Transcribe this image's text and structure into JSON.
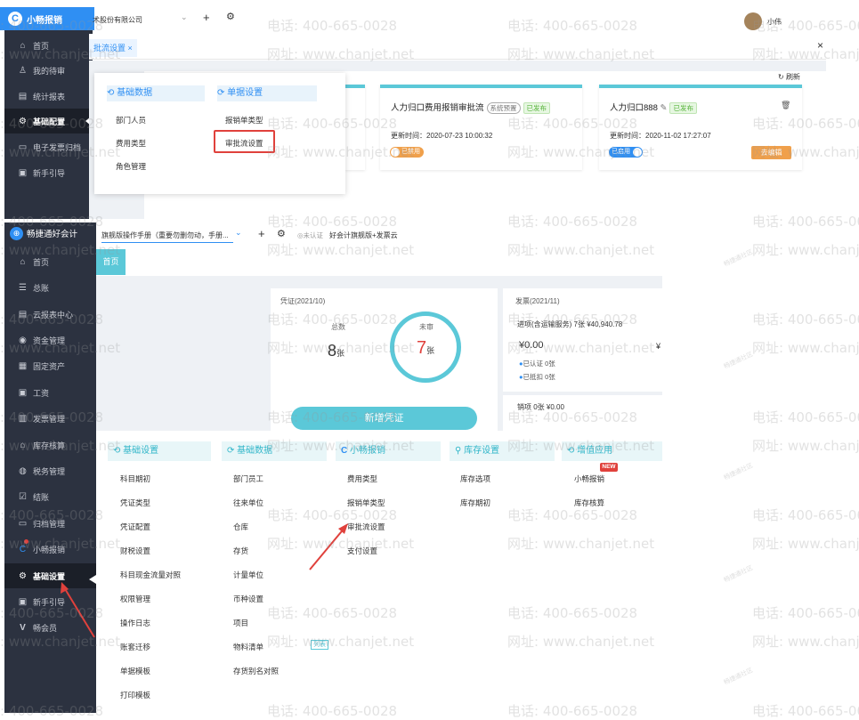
{
  "top": {
    "brand": "小畅报销",
    "company": "术股份有限公司",
    "user_name": "小伟",
    "tab_label": "批流设置",
    "refresh_label": "刷新",
    "sidebar": [
      {
        "label": "首页",
        "icon": "home-icon"
      },
      {
        "label": "我的待审",
        "icon": "person-icon"
      },
      {
        "label": "统计报表",
        "icon": "chart-icon"
      },
      {
        "label": "基础配置",
        "icon": "gear-icon",
        "active": true
      },
      {
        "label": "电子发票归档",
        "icon": "archive-icon"
      },
      {
        "label": "新手引导",
        "icon": "guide-icon"
      }
    ],
    "dropdown": {
      "basic_data_title": "基础数据",
      "basic_data_items": [
        "部门人员",
        "费用类型",
        "角色管理"
      ],
      "doc_settings_title": "单据设置",
      "doc_settings_items": [
        "报销单类型",
        "审批流设置"
      ]
    },
    "cards": [
      {
        "title": "人力归口费用报销审批流",
        "sys_badge": "系统预置",
        "status": "已发布",
        "time": "更新时间：2020-07-23 10:00:32",
        "toggle": "已禁用"
      },
      {
        "title": "人力归口888",
        "status": "已发布",
        "time": "更新时间：2020-11-02 17:27:07",
        "toggle": "已启用",
        "button": "去编辑"
      }
    ]
  },
  "bottom": {
    "brand": "畅捷通好会计",
    "account_select": "旗舰版操作手册（重要勿删勿动，手册...",
    "cert_status": "未认证",
    "account_plan": "好会计旗舰版+发票云",
    "home_tab": "首页",
    "sidebar": [
      {
        "label": "首页",
        "icon": "home-icon"
      },
      {
        "label": "总账",
        "icon": "ledger-icon"
      },
      {
        "label": "云报表中心",
        "icon": "chart-icon"
      },
      {
        "label": "资金管理",
        "icon": "money-icon"
      },
      {
        "label": "固定资产",
        "icon": "asset-icon"
      },
      {
        "label": "工资",
        "icon": "salary-icon"
      },
      {
        "label": "发票管理",
        "icon": "invoice-icon"
      },
      {
        "label": "库存核算",
        "icon": "warehouse-icon"
      },
      {
        "label": "税务管理",
        "icon": "tax-icon"
      },
      {
        "label": "结账",
        "icon": "checkout-icon"
      },
      {
        "label": "归档管理",
        "icon": "archive-icon"
      },
      {
        "label": "小畅报销",
        "icon": "brand-icon"
      },
      {
        "label": "基础设置",
        "icon": "gear-icon",
        "active": true
      },
      {
        "label": "新手引导",
        "icon": "guide-icon"
      },
      {
        "label": "畅会员",
        "icon": "vip-icon"
      }
    ],
    "voucher": {
      "title": "凭证(2021/10)",
      "total_label": "总数",
      "total_value": "8",
      "unit": "张",
      "pending_label": "未审",
      "pending_value": "7",
      "button": "新增凭证"
    },
    "invoice": {
      "title": "发票(2021/11)",
      "input_line": "进项(含运输服务) 7张 ¥40,940.78",
      "amount": "¥0.00",
      "certified": "已认证  0张",
      "deducted": "已抵扣  0张",
      "output_line": "销项  0张  ¥0.00"
    },
    "menu": {
      "basic_settings": {
        "title": "基础设置",
        "items": [
          "科目期初",
          "凭证类型",
          "凭证配置",
          "财税设置",
          "科目现金流量对照",
          "权限管理",
          "操作日志",
          "账套迁移",
          "单据模板",
          "打印模板"
        ]
      },
      "basic_data": {
        "title": "基础数据",
        "items": [
          "部门员工",
          "往来单位",
          "仓库",
          "存货",
          "计量单位",
          "币种设置",
          "项目",
          "物料清单",
          "存货别名对照"
        ],
        "bom_tag": "列表"
      },
      "xiaochang": {
        "title": "小畅报销",
        "items": [
          "费用类型",
          "报销单类型",
          "审批流设置",
          "支付设置"
        ]
      },
      "inventory": {
        "title": "库存设置",
        "items": [
          "库存选项",
          "库存期初"
        ]
      },
      "value_added": {
        "title": "增值应用",
        "items": [
          "小畅报销",
          "库存核算"
        ],
        "new_badge": "NEW"
      }
    }
  },
  "watermark": {
    "phone": "电话: 400-665-0028",
    "site": "网址: www.chanjet.net",
    "small": "畅捷通社区"
  }
}
